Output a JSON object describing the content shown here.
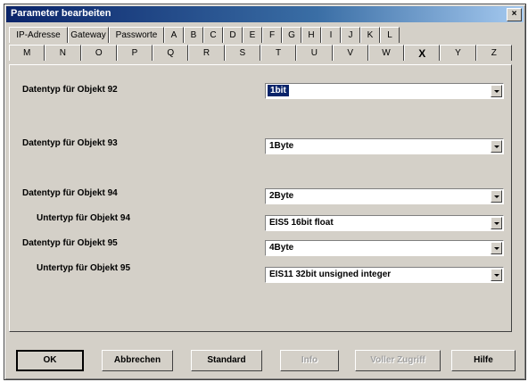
{
  "window": {
    "title": "Parameter bearbeiten",
    "close_label": "×"
  },
  "tabs_row1": [
    "IP-Adresse",
    "Gateway",
    "Passworte",
    "A",
    "B",
    "C",
    "D",
    "E",
    "F",
    "G",
    "H",
    "I",
    "J",
    "K",
    "L"
  ],
  "tabs_row2": [
    "M",
    "N",
    "O",
    "P",
    "Q",
    "R",
    "S",
    "T",
    "U",
    "V",
    "W",
    "X",
    "Y",
    "Z"
  ],
  "active_tab": "X",
  "params": [
    {
      "label": "Datentyp für Objekt 92",
      "value": "1bit"
    },
    {
      "label": "Datentyp für Objekt 93",
      "value": "1Byte"
    },
    {
      "label": "Datentyp für Objekt 94",
      "value": "2Byte"
    },
    {
      "label": "Untertyp für Objekt 94",
      "value": "EIS5  16bit float"
    },
    {
      "label": "Datentyp für Objekt 95",
      "value": "4Byte"
    },
    {
      "label": "Untertyp für Objekt 95",
      "value": "EIS11 32bit unsigned integer"
    }
  ],
  "buttons": {
    "ok": "OK",
    "cancel": "Abbrechen",
    "standard": "Standard",
    "info": "Info",
    "full_access": "Voller Zugriff",
    "help": "Hilfe"
  }
}
